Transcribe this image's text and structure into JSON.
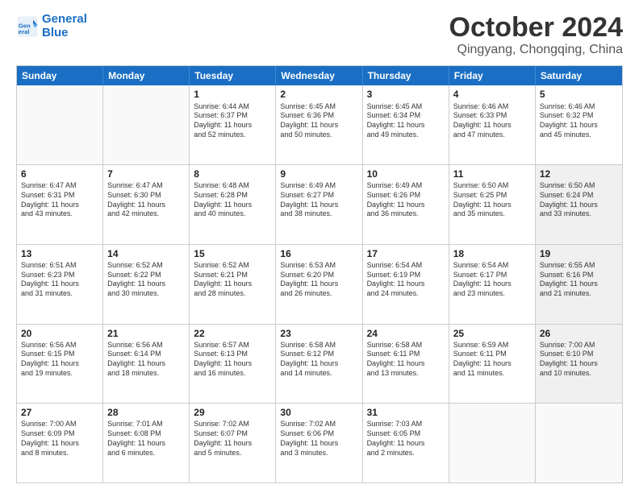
{
  "header": {
    "logo_general": "General",
    "logo_blue": "Blue",
    "month_title": "October 2024",
    "location": "Qingyang, Chongqing, China"
  },
  "days_of_week": [
    "Sunday",
    "Monday",
    "Tuesday",
    "Wednesday",
    "Thursday",
    "Friday",
    "Saturday"
  ],
  "weeks": [
    [
      {
        "day": "",
        "info": "",
        "empty": true
      },
      {
        "day": "",
        "info": "",
        "empty": true
      },
      {
        "day": "1",
        "info": "Sunrise: 6:44 AM\nSunset: 6:37 PM\nDaylight: 11 hours\nand 52 minutes."
      },
      {
        "day": "2",
        "info": "Sunrise: 6:45 AM\nSunset: 6:36 PM\nDaylight: 11 hours\nand 50 minutes."
      },
      {
        "day": "3",
        "info": "Sunrise: 6:45 AM\nSunset: 6:34 PM\nDaylight: 11 hours\nand 49 minutes."
      },
      {
        "day": "4",
        "info": "Sunrise: 6:46 AM\nSunset: 6:33 PM\nDaylight: 11 hours\nand 47 minutes."
      },
      {
        "day": "5",
        "info": "Sunrise: 6:46 AM\nSunset: 6:32 PM\nDaylight: 11 hours\nand 45 minutes."
      }
    ],
    [
      {
        "day": "6",
        "info": "Sunrise: 6:47 AM\nSunset: 6:31 PM\nDaylight: 11 hours\nand 43 minutes."
      },
      {
        "day": "7",
        "info": "Sunrise: 6:47 AM\nSunset: 6:30 PM\nDaylight: 11 hours\nand 42 minutes."
      },
      {
        "day": "8",
        "info": "Sunrise: 6:48 AM\nSunset: 6:28 PM\nDaylight: 11 hours\nand 40 minutes."
      },
      {
        "day": "9",
        "info": "Sunrise: 6:49 AM\nSunset: 6:27 PM\nDaylight: 11 hours\nand 38 minutes."
      },
      {
        "day": "10",
        "info": "Sunrise: 6:49 AM\nSunset: 6:26 PM\nDaylight: 11 hours\nand 36 minutes."
      },
      {
        "day": "11",
        "info": "Sunrise: 6:50 AM\nSunset: 6:25 PM\nDaylight: 11 hours\nand 35 minutes."
      },
      {
        "day": "12",
        "info": "Sunrise: 6:50 AM\nSunset: 6:24 PM\nDaylight: 11 hours\nand 33 minutes.",
        "shaded": true
      }
    ],
    [
      {
        "day": "13",
        "info": "Sunrise: 6:51 AM\nSunset: 6:23 PM\nDaylight: 11 hours\nand 31 minutes."
      },
      {
        "day": "14",
        "info": "Sunrise: 6:52 AM\nSunset: 6:22 PM\nDaylight: 11 hours\nand 30 minutes."
      },
      {
        "day": "15",
        "info": "Sunrise: 6:52 AM\nSunset: 6:21 PM\nDaylight: 11 hours\nand 28 minutes."
      },
      {
        "day": "16",
        "info": "Sunrise: 6:53 AM\nSunset: 6:20 PM\nDaylight: 11 hours\nand 26 minutes."
      },
      {
        "day": "17",
        "info": "Sunrise: 6:54 AM\nSunset: 6:19 PM\nDaylight: 11 hours\nand 24 minutes."
      },
      {
        "day": "18",
        "info": "Sunrise: 6:54 AM\nSunset: 6:17 PM\nDaylight: 11 hours\nand 23 minutes."
      },
      {
        "day": "19",
        "info": "Sunrise: 6:55 AM\nSunset: 6:16 PM\nDaylight: 11 hours\nand 21 minutes.",
        "shaded": true
      }
    ],
    [
      {
        "day": "20",
        "info": "Sunrise: 6:56 AM\nSunset: 6:15 PM\nDaylight: 11 hours\nand 19 minutes."
      },
      {
        "day": "21",
        "info": "Sunrise: 6:56 AM\nSunset: 6:14 PM\nDaylight: 11 hours\nand 18 minutes."
      },
      {
        "day": "22",
        "info": "Sunrise: 6:57 AM\nSunset: 6:13 PM\nDaylight: 11 hours\nand 16 minutes."
      },
      {
        "day": "23",
        "info": "Sunrise: 6:58 AM\nSunset: 6:12 PM\nDaylight: 11 hours\nand 14 minutes."
      },
      {
        "day": "24",
        "info": "Sunrise: 6:58 AM\nSunset: 6:11 PM\nDaylight: 11 hours\nand 13 minutes."
      },
      {
        "day": "25",
        "info": "Sunrise: 6:59 AM\nSunset: 6:11 PM\nDaylight: 11 hours\nand 11 minutes."
      },
      {
        "day": "26",
        "info": "Sunrise: 7:00 AM\nSunset: 6:10 PM\nDaylight: 11 hours\nand 10 minutes.",
        "shaded": true
      }
    ],
    [
      {
        "day": "27",
        "info": "Sunrise: 7:00 AM\nSunset: 6:09 PM\nDaylight: 11 hours\nand 8 minutes."
      },
      {
        "day": "28",
        "info": "Sunrise: 7:01 AM\nSunset: 6:08 PM\nDaylight: 11 hours\nand 6 minutes."
      },
      {
        "day": "29",
        "info": "Sunrise: 7:02 AM\nSunset: 6:07 PM\nDaylight: 11 hours\nand 5 minutes."
      },
      {
        "day": "30",
        "info": "Sunrise: 7:02 AM\nSunset: 6:06 PM\nDaylight: 11 hours\nand 3 minutes."
      },
      {
        "day": "31",
        "info": "Sunrise: 7:03 AM\nSunset: 6:05 PM\nDaylight: 11 hours\nand 2 minutes."
      },
      {
        "day": "",
        "info": "",
        "empty": true
      },
      {
        "day": "",
        "info": "",
        "empty": true
      }
    ]
  ]
}
